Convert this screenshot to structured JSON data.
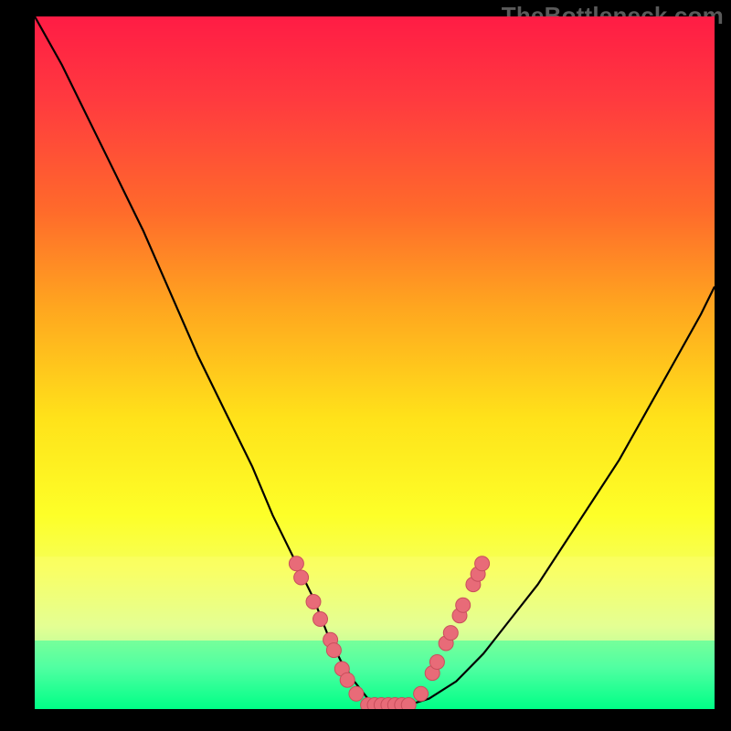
{
  "watermark_text": "TheBottleneck.com",
  "palette": {
    "background": "#000000",
    "gradient_stops": [
      {
        "offset": 0.0,
        "color": "#ff1c45"
      },
      {
        "offset": 0.12,
        "color": "#ff3a3f"
      },
      {
        "offset": 0.28,
        "color": "#ff6a2b"
      },
      {
        "offset": 0.42,
        "color": "#ffa61f"
      },
      {
        "offset": 0.58,
        "color": "#ffe21a"
      },
      {
        "offset": 0.72,
        "color": "#fdff28"
      },
      {
        "offset": 0.8,
        "color": "#f6ff5a"
      },
      {
        "offset": 0.88,
        "color": "#d6ffa0"
      },
      {
        "offset": 0.94,
        "color": "#7cffb0"
      },
      {
        "offset": 1.0,
        "color": "#00ff87"
      }
    ],
    "curve_color": "#000000",
    "marker_fill": "#e86b78",
    "marker_stroke": "#c94e5c",
    "band_top": "#feff7a",
    "band_bottom": "#00ff87"
  },
  "chart_data": {
    "type": "line",
    "title": "",
    "xlabel": "",
    "ylabel": "",
    "xlim": [
      0,
      100
    ],
    "ylim": [
      0,
      100
    ],
    "series": [
      {
        "name": "bottleneck-curve",
        "x": [
          0,
          4,
          8,
          12,
          16,
          20,
          24,
          28,
          32,
          35,
          38,
          41,
          43,
          45,
          47,
          49,
          51,
          53,
          55,
          58,
          62,
          66,
          70,
          74,
          78,
          82,
          86,
          90,
          94,
          98,
          100
        ],
        "y": [
          100,
          93,
          85,
          77,
          69,
          60,
          51,
          43,
          35,
          28,
          22,
          16,
          11,
          7,
          4,
          1.5,
          0.6,
          0.6,
          0.6,
          1.5,
          4,
          8,
          13,
          18,
          24,
          30,
          36,
          43,
          50,
          57,
          61
        ]
      }
    ],
    "markers": {
      "name": "highlighted-points",
      "points": [
        {
          "x": 38.5,
          "y": 21
        },
        {
          "x": 39.2,
          "y": 19
        },
        {
          "x": 41.0,
          "y": 15.5
        },
        {
          "x": 42.0,
          "y": 13
        },
        {
          "x": 43.5,
          "y": 10
        },
        {
          "x": 44.0,
          "y": 8.5
        },
        {
          "x": 45.2,
          "y": 5.8
        },
        {
          "x": 46.0,
          "y": 4.2
        },
        {
          "x": 47.3,
          "y": 2.2
        },
        {
          "x": 49.0,
          "y": 0.6
        },
        {
          "x": 50.0,
          "y": 0.6
        },
        {
          "x": 51.0,
          "y": 0.6
        },
        {
          "x": 52.0,
          "y": 0.6
        },
        {
          "x": 53.0,
          "y": 0.6
        },
        {
          "x": 54.0,
          "y": 0.6
        },
        {
          "x": 55.0,
          "y": 0.6
        },
        {
          "x": 56.8,
          "y": 2.2
        },
        {
          "x": 58.5,
          "y": 5.2
        },
        {
          "x": 59.2,
          "y": 6.8
        },
        {
          "x": 60.5,
          "y": 9.5
        },
        {
          "x": 61.2,
          "y": 11
        },
        {
          "x": 62.5,
          "y": 13.5
        },
        {
          "x": 63.0,
          "y": 15
        },
        {
          "x": 64.5,
          "y": 18
        },
        {
          "x": 65.2,
          "y": 19.5
        },
        {
          "x": 65.8,
          "y": 21
        }
      ]
    },
    "flat_bottom_segment": {
      "x_start": 48.5,
      "x_end": 55.5,
      "y": 0.6
    },
    "green_band": {
      "y_top_approx": 22,
      "y_bottom": 0
    }
  }
}
